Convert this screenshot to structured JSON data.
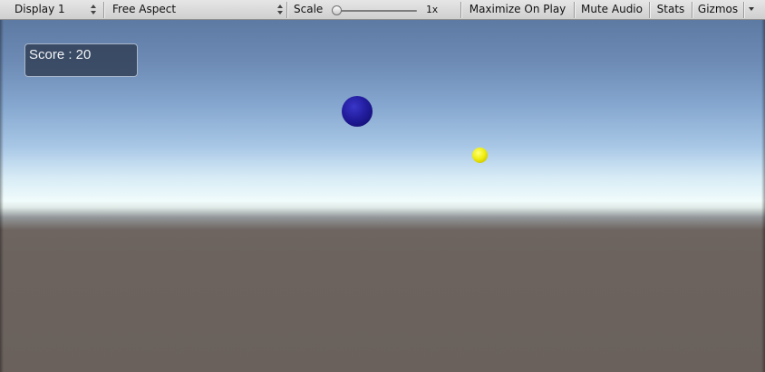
{
  "toolbar": {
    "display_label": "Display 1",
    "aspect_label": "Free Aspect",
    "scale_label": "Scale",
    "scale_value": "1x",
    "scale_slider_fraction": 0.0,
    "maximize_label": "Maximize On Play",
    "mute_label": "Mute Audio",
    "stats_label": "Stats",
    "gizmos_label": "Gizmos"
  },
  "game": {
    "score_text": "Score : 20",
    "objects": [
      {
        "name": "blue-sphere",
        "color": "#221d9e"
      },
      {
        "name": "yellow-sphere",
        "color": "#f0ee10"
      }
    ]
  },
  "colors": {
    "toolbar_bg": "#d8d8d8",
    "sky_top": "#5d7aa3",
    "horizon": "#f0fbfb",
    "ground": "#6c635e",
    "score_panel_bg": "#2d3a50"
  }
}
